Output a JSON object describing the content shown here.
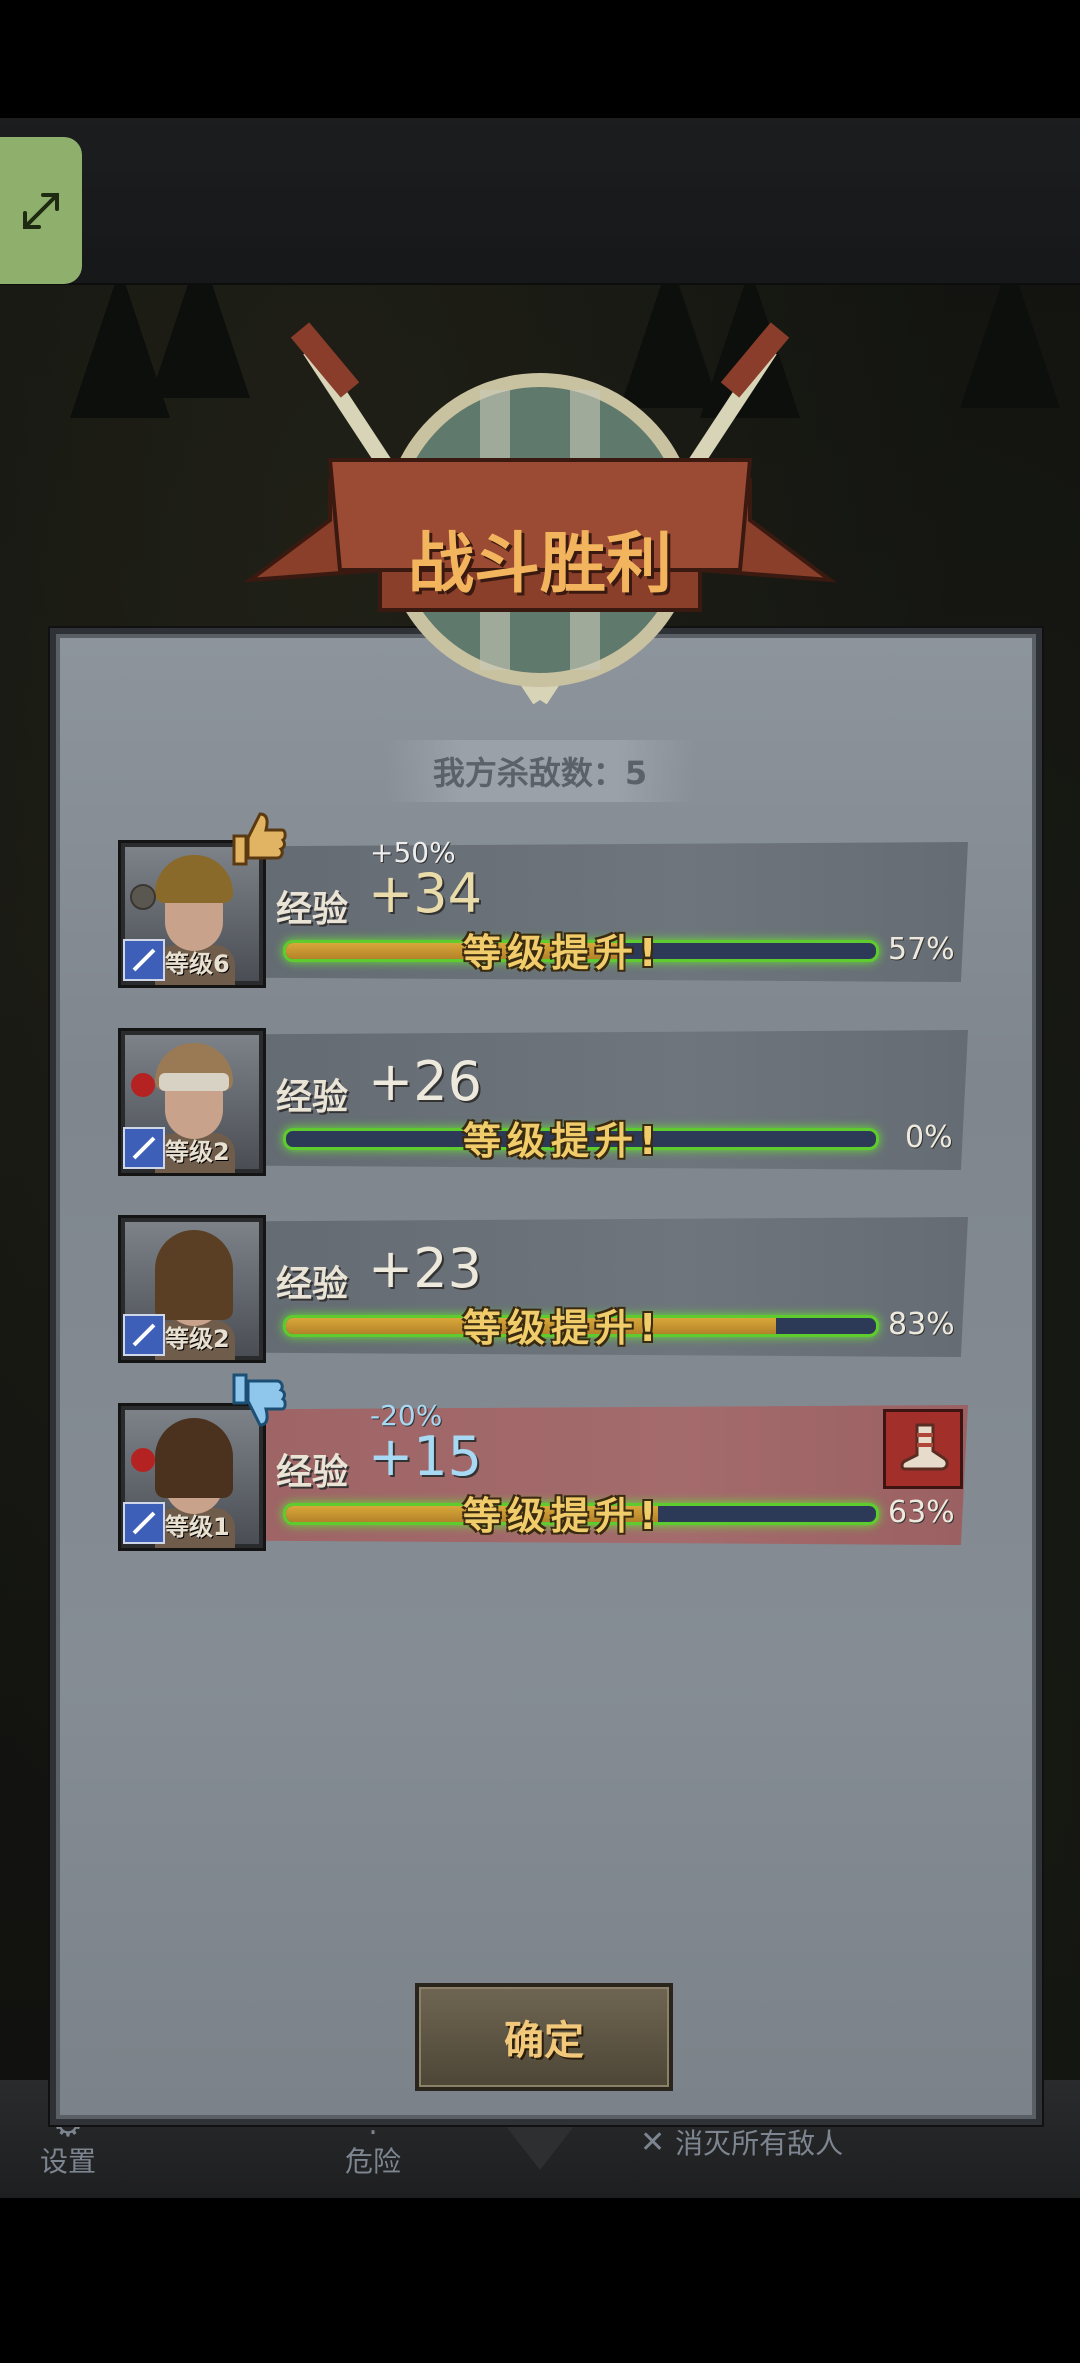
{
  "title": "战斗胜利",
  "kills": {
    "label": "我方杀敌数：5"
  },
  "exp_label": "经验",
  "level_up_text": "等级提升!",
  "confirm_label": "确定",
  "bottom_bar": {
    "settings": "设置",
    "danger": "危险",
    "objective": "消灭所有敌人"
  },
  "heroes": [
    {
      "level": "等级6",
      "bonus": "+50%",
      "exp": "+34",
      "progress": 0.57,
      "percent": "57%",
      "feedback": "thumbs-up-icon"
    },
    {
      "level": "等级2",
      "bonus": "",
      "exp": "+26",
      "progress": 0.0,
      "percent": "0%",
      "feedback": ""
    },
    {
      "level": "等级2",
      "bonus": "",
      "exp": "+23",
      "progress": 0.83,
      "percent": "83%",
      "feedback": ""
    },
    {
      "level": "等级1",
      "bonus": "-20%",
      "exp": "+15",
      "progress": 0.63,
      "percent": "63%",
      "feedback": "thumbs-down-icon",
      "item": "boot-icon"
    }
  ],
  "colors": {
    "bar_border": "#5ecb2e",
    "bar_fill": "#d7a83a",
    "level_up": "#f0cd6a",
    "penalty_row": "#a46b6d",
    "expand_button": "#8fb06d"
  }
}
